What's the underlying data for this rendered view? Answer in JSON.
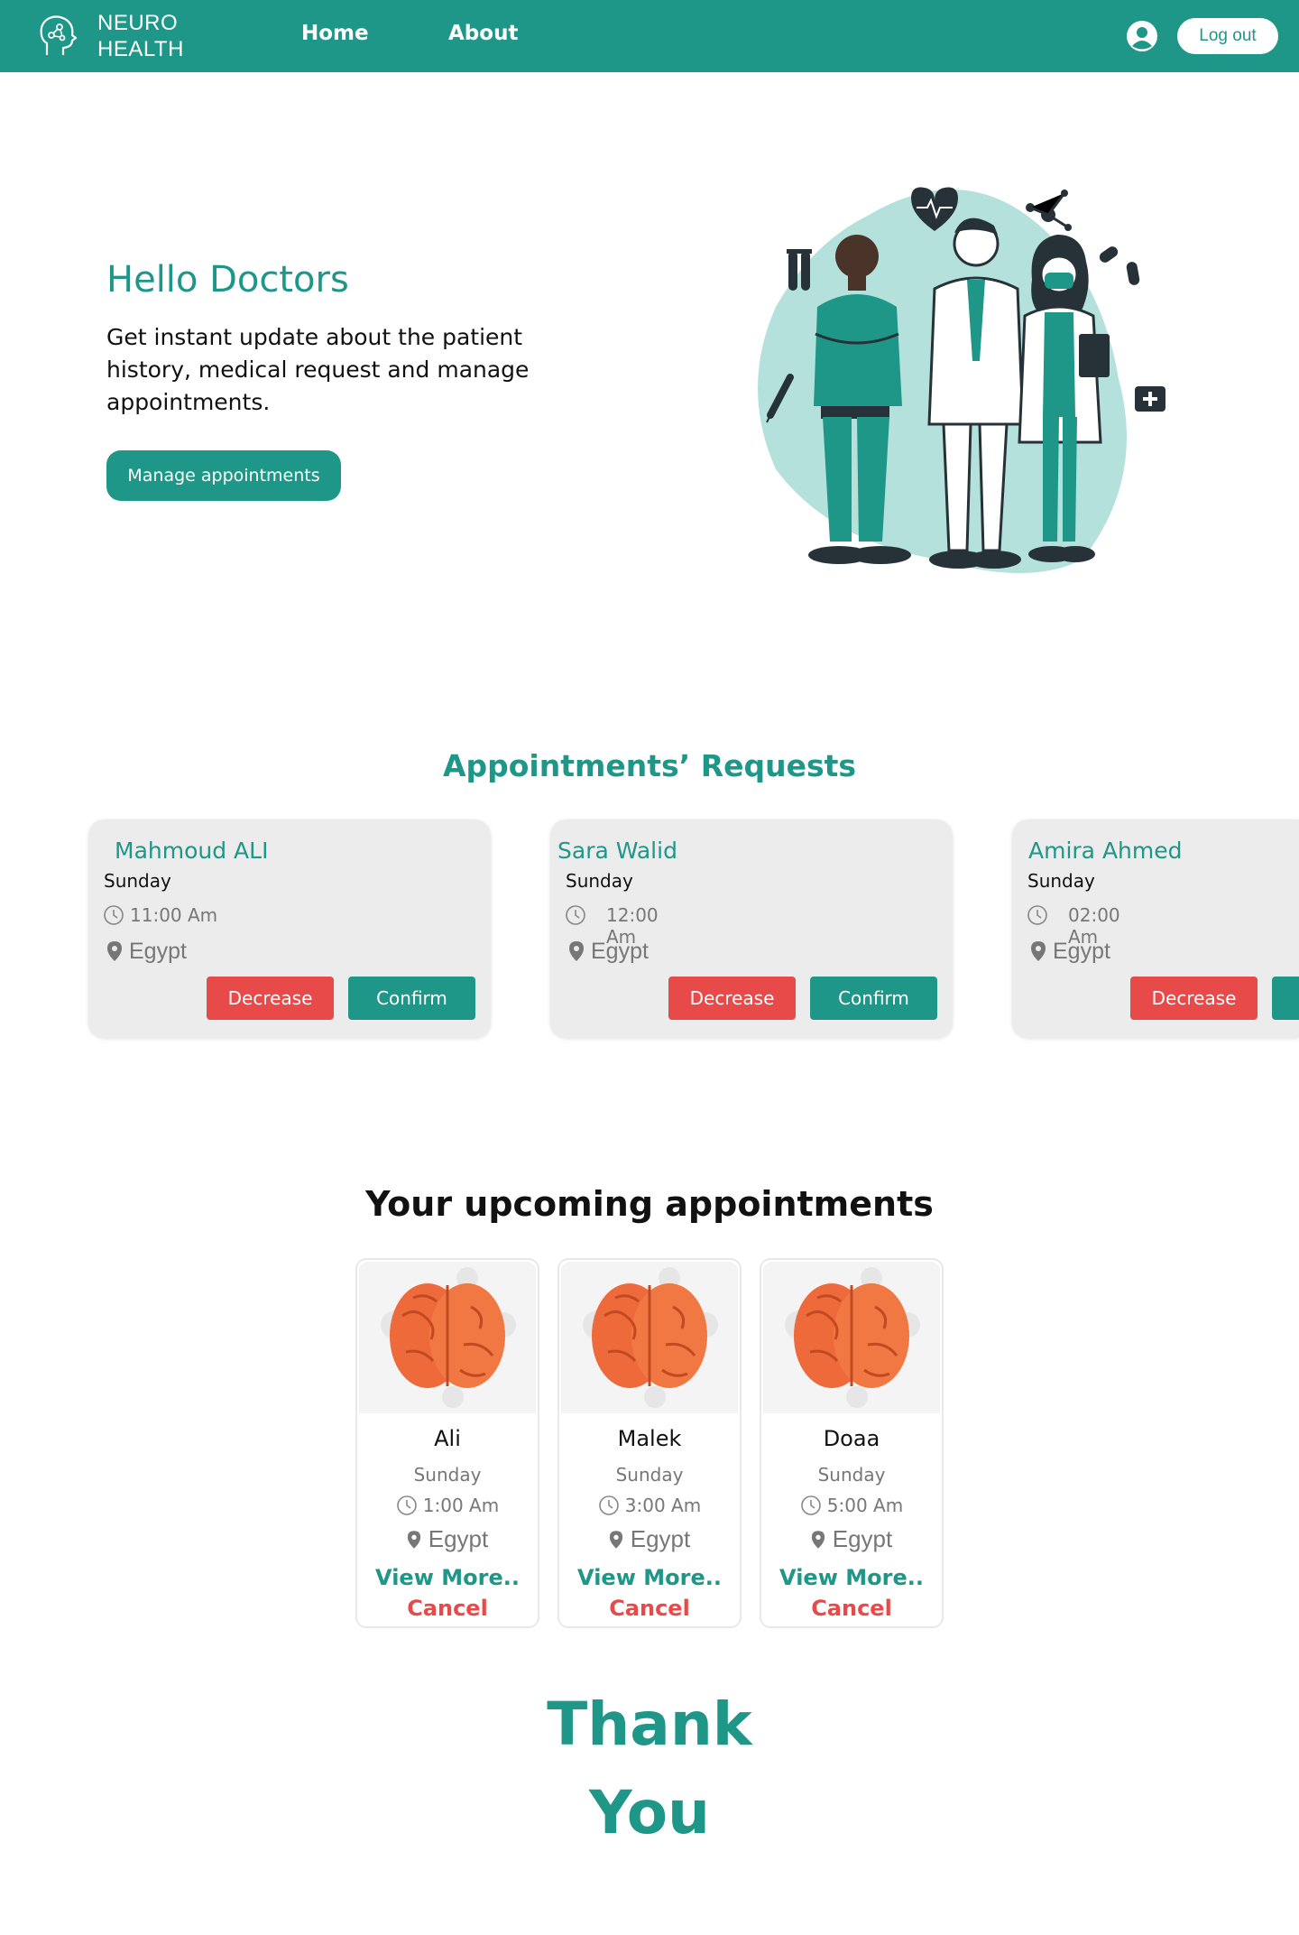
{
  "nav": {
    "brand_line1": "NEURO",
    "brand_line2": "HEALTH",
    "links": [
      "Home",
      "About"
    ],
    "logout": "Log out"
  },
  "hero": {
    "title": "Hello Doctors",
    "text": "Get instant update about the patient history, medical request and manage appointments.",
    "button": "Manage appointments"
  },
  "requests": {
    "title": "Appointments’ Requests",
    "decrease_label": "Decrease",
    "confirm_label": "Confirm",
    "items": [
      {
        "name": "Mahmoud ALI",
        "day": "Sunday",
        "time": "11:00 Am",
        "location": "Egypt"
      },
      {
        "name": "Sara Walid",
        "day": "Sunday",
        "time": "12:00 Am",
        "location": "Egypt"
      },
      {
        "name": "Amira  Ahmed",
        "day": "Sunday",
        "time": "02:00 Am",
        "location": "Egypt"
      }
    ]
  },
  "upcoming": {
    "title": "Your upcoming appointments",
    "view_more_label": "View More..",
    "cancel_label": "Cancel",
    "items": [
      {
        "name": "Ali",
        "day": "Sunday",
        "time": "1:00 Am",
        "location": "Egypt"
      },
      {
        "name": "Malek",
        "day": "Sunday",
        "time": "3:00 Am",
        "location": "Egypt"
      },
      {
        "name": "Doaa",
        "day": "Sunday",
        "time": "5:00 Am",
        "location": "Egypt"
      }
    ]
  },
  "footer": {
    "thanks_line1": "Thank",
    "thanks_line2": "You"
  },
  "colors": {
    "primary": "#1e9688",
    "danger": "#e84a4a",
    "card_bg": "#ececec",
    "muted_text": "#777777"
  },
  "icons": [
    "brain-head-icon",
    "user-icon",
    "clock-icon",
    "location-pin-icon",
    "brain-icon"
  ]
}
